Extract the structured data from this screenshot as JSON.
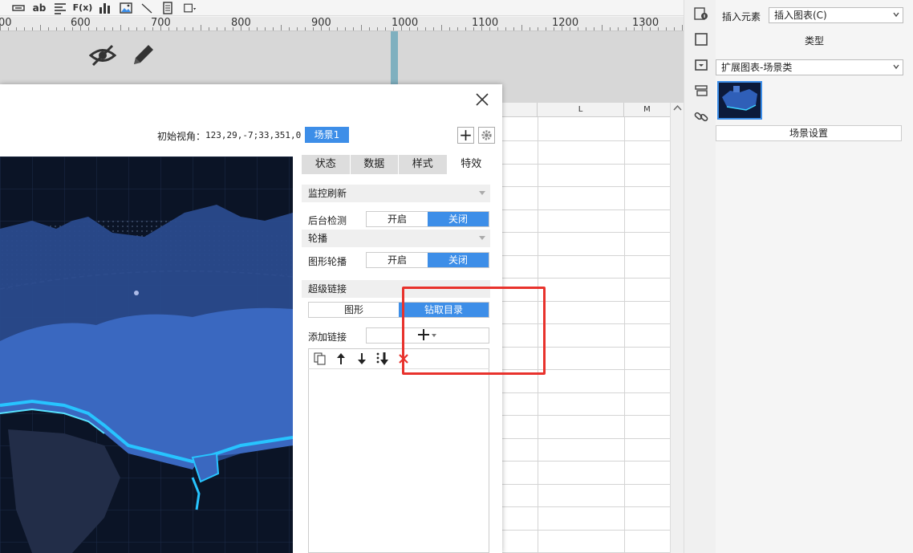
{
  "toolbar": {
    "icons": [
      "text-field-icon",
      "ab-text-icon",
      "align-left-icon",
      "formula-icon",
      "bar-chart-icon",
      "image-icon",
      "slash-icon",
      "document-icon",
      "border-icon"
    ],
    "ab_label": "ab",
    "formula_label": "F(x)"
  },
  "ruler": {
    "labels": [
      "00",
      "600",
      "700",
      "800",
      "900",
      "1000",
      "1100",
      "1200",
      "1300"
    ]
  },
  "canvas": {
    "hide_icon": "eye-slash-icon",
    "edit_icon": "pencil-icon"
  },
  "sheet": {
    "columns": [
      "L",
      "M"
    ]
  },
  "dialog": {
    "view_label": "初始视角：",
    "view_value": "123,29,-7;33,351,0",
    "scene_tab": "场景1",
    "add_label": "+",
    "tabs": [
      {
        "label": "状态",
        "active": false
      },
      {
        "label": "数据",
        "active": false
      },
      {
        "label": "样式",
        "active": false
      },
      {
        "label": "特效",
        "active": true
      }
    ],
    "sections": {
      "monitor_refresh": "监控刷新",
      "background_check": "后台检测",
      "carousel": "轮播",
      "graphic_carousel": "图形轮播",
      "hyperlink": "超级链接",
      "add_link": "添加链接"
    },
    "toggle_open": "开启",
    "toggle_close": "关闭",
    "link_type": {
      "graphic": "图形",
      "drill": "钻取目录"
    },
    "link_tools": [
      "copy-icon",
      "arrow-up-icon",
      "arrow-down-icon",
      "move-bottom-icon",
      "delete-icon"
    ],
    "highlight_color": "#e8322c"
  },
  "sidebar": {
    "insert_label": "插入元素",
    "insert_value": "插入图表(C)",
    "type_header": "类型",
    "type_value": "扩展图表-场景类",
    "scene_settings": "场景设置"
  },
  "colors": {
    "accent": "#3d8ee8",
    "highlight": "#e8322c"
  }
}
